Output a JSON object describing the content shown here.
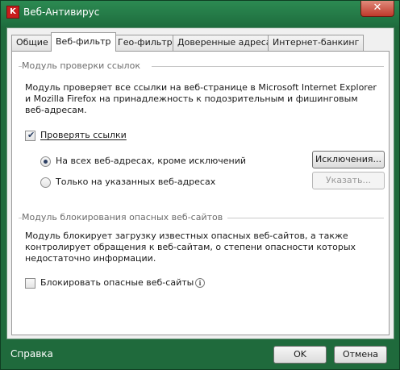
{
  "window": {
    "title": "Веб-Антивирус",
    "app_icon": "kaspersky-k-icon",
    "close_glyph": "✕"
  },
  "tabs": [
    {
      "label": "Общие",
      "active": false
    },
    {
      "label": "Веб-фильтр",
      "active": true
    },
    {
      "label": "Гео-фильтр",
      "active": false
    },
    {
      "label": "Доверенные адреса",
      "active": false
    },
    {
      "label": "Интернет-банкинг",
      "active": false
    }
  ],
  "link_module": {
    "header": "Модуль проверки ссылок",
    "description": "Модуль проверяет все ссылки на веб-странице в Microsoft Internet Explorer и Mozilla Firefox на принадлежность к подозрительным и фишинговым веб-адресам.",
    "check_links": {
      "label": "Проверять ссылки",
      "checked": true
    },
    "radio_all": {
      "label": "На всех веб-адресах, кроме исключений",
      "selected": true
    },
    "radio_specified": {
      "label": "Только на указанных веб-адресах",
      "selected": false
    },
    "exceptions_button": "Исключения...",
    "specify_button": "Указать..."
  },
  "block_module": {
    "header": "Модуль блокирования опасных веб-сайтов",
    "description": "Модуль блокирует загрузку известных опасных веб-сайтов, а также контролирует обращения к веб-сайтам, о степени опасности которых недостаточно информации.",
    "block_sites": {
      "label": "Блокировать опасные веб-сайты",
      "checked": false
    },
    "info_glyph": "i"
  },
  "footer": {
    "help_link": "Справка",
    "ok_button": "OK",
    "cancel_button": "Отмена"
  },
  "colors": {
    "frame": "#1f6a3c",
    "accent": "#2c8a52",
    "close": "#c0392b"
  }
}
